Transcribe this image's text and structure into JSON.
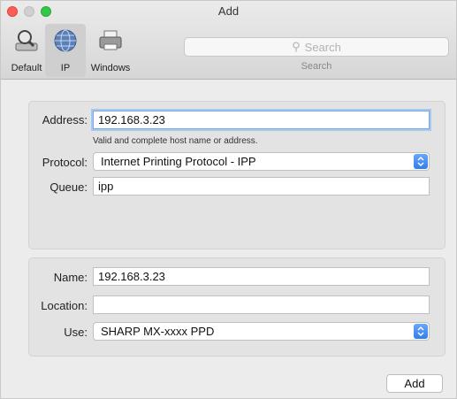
{
  "window": {
    "title": "Add"
  },
  "toolbar": {
    "items": [
      {
        "label": "Default",
        "active": false
      },
      {
        "label": "IP",
        "active": true
      },
      {
        "label": "Windows",
        "active": false
      }
    ],
    "search": {
      "placeholder": "Search",
      "caption": "Search"
    }
  },
  "form": {
    "address": {
      "label": "Address:",
      "value": "192.168.3.23",
      "hint": "Valid and complete host name or address."
    },
    "protocol": {
      "label": "Protocol:",
      "value": "Internet Printing Protocol - IPP"
    },
    "queue": {
      "label": "Queue:",
      "value": "ipp"
    },
    "name": {
      "label": "Name:",
      "value": "192.168.3.23"
    },
    "location": {
      "label": "Location:",
      "value": ""
    },
    "use": {
      "label": "Use:",
      "value": "SHARP MX-xxxx PPD"
    }
  },
  "footer": {
    "add_label": "Add"
  },
  "colors": {
    "accent": "#2f7ef0",
    "close": "#fc5f57",
    "zoom": "#33c748"
  }
}
